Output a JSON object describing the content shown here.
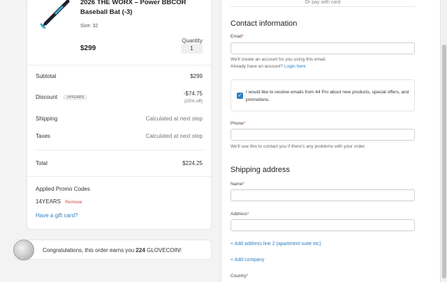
{
  "order_summary": {
    "product": {
      "title": "2026 THE WORX – Power BBCOR Baseball Bat (-3)",
      "size": "Size: 32",
      "price": "$299",
      "quantity_label": "Quantity",
      "quantity": "1"
    },
    "subtotal": {
      "label": "Subtotal",
      "value": "$299"
    },
    "discount": {
      "label": "Discount",
      "code_badge": "14YEARS",
      "value": "-$74.75",
      "note": "(25% off)"
    },
    "shipping": {
      "label": "Shipping",
      "value": "Calculated at next step"
    },
    "taxes": {
      "label": "Taxes",
      "value": "Calculated at next step"
    },
    "total": {
      "label": "Total",
      "value": "$224.25"
    },
    "promo": {
      "title": "Applied Promo Codes",
      "code": "14YEARS",
      "remove_label": "Remove"
    },
    "gift_card_link": "Have a gift card?"
  },
  "coin_banner": {
    "prefix": "Congratulations, this order earns you",
    "amount": "224",
    "suffix": "GLOVECOIN!"
  },
  "checkout_form": {
    "pay_with_card": "Or pay with card",
    "contact_title": "Contact information",
    "email_label": "Email",
    "email_help": "We'll create an account for you using this email.",
    "have_account": "Already have an account?",
    "login_link": "Login here",
    "consent_text": "I would like to receive emails from 44 Pro about new products, special offers, and promotions.",
    "consent_checked": true,
    "phone_label": "Phone",
    "phone_help": "We'll use this to contact you if there's any problems with your order.",
    "shipping_title": "Shipping address",
    "name_label": "Name",
    "address_label": "Address",
    "add_address_line": "+ Add address line 2 (apartment suite etc)",
    "add_company": "+ Add company",
    "country_label": "Country",
    "required_mark": "*"
  },
  "colors": {
    "link": "#2f7fc1",
    "required": "#d0453c",
    "checkbox": "#2f7fc1"
  }
}
